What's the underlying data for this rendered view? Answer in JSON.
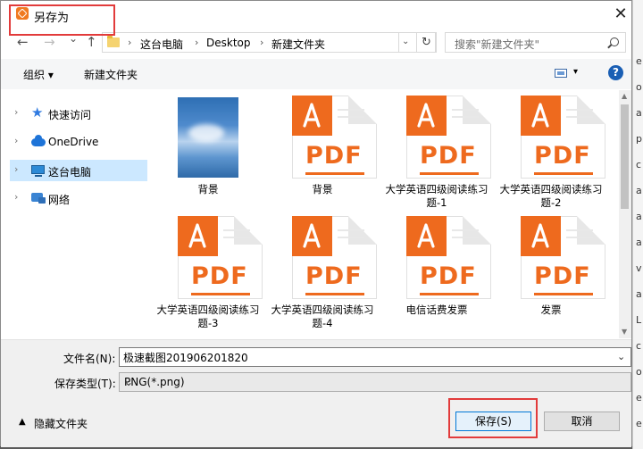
{
  "dialog": {
    "title": "另存为",
    "close_glyph": "✕"
  },
  "nav": {
    "back": "←",
    "forward": "→",
    "dropdown": "⌄",
    "up": "↑"
  },
  "address": {
    "crumbs": [
      "这台电脑",
      "Desktop",
      "新建文件夹"
    ],
    "refresh_glyph": "↻"
  },
  "search": {
    "placeholder": "搜索\"新建文件夹\""
  },
  "toolbar": {
    "organize": "组织 ▾",
    "new_folder": "新建文件夹",
    "view_dd": "▾",
    "help": "?"
  },
  "sidebar": {
    "items": [
      {
        "label": "快速访问"
      },
      {
        "label": "OneDrive"
      },
      {
        "label": "这台电脑"
      },
      {
        "label": "网络"
      }
    ]
  },
  "files": [
    {
      "name": "背景",
      "kind": "image"
    },
    {
      "name": "背景",
      "kind": "pdf"
    },
    {
      "name": "大学英语四级阅读练习题-1",
      "kind": "pdf"
    },
    {
      "name": "大学英语四级阅读练习题-2",
      "kind": "pdf"
    },
    {
      "name": "大学英语四级阅读练习题-3",
      "kind": "pdf"
    },
    {
      "name": "大学英语四级阅读练习题-4",
      "kind": "pdf"
    },
    {
      "name": "电信话费发票",
      "kind": "pdf"
    },
    {
      "name": "发票",
      "kind": "pdf"
    }
  ],
  "pdf_mark": "PDF",
  "form": {
    "filename_label": "文件名(N):",
    "filename_value": "极速截图201906201820",
    "filetype_label": "保存类型(T):",
    "filetype_value": "PNG(*.png)"
  },
  "footer": {
    "hide_folders": "隐藏文件夹",
    "save": "保存(S)",
    "cancel": "取消"
  },
  "background_right_letters": [
    "e",
    "o",
    "a",
    "p",
    "c",
    "a",
    "a",
    "a",
    "v",
    "a",
    "L",
    "c",
    "o",
    "e",
    "e"
  ],
  "colors": {
    "accent": "#0078d7",
    "pdf_orange": "#ee6a1e",
    "highlight_red": "#e23b3b",
    "selected_bg": "#cce8ff"
  }
}
